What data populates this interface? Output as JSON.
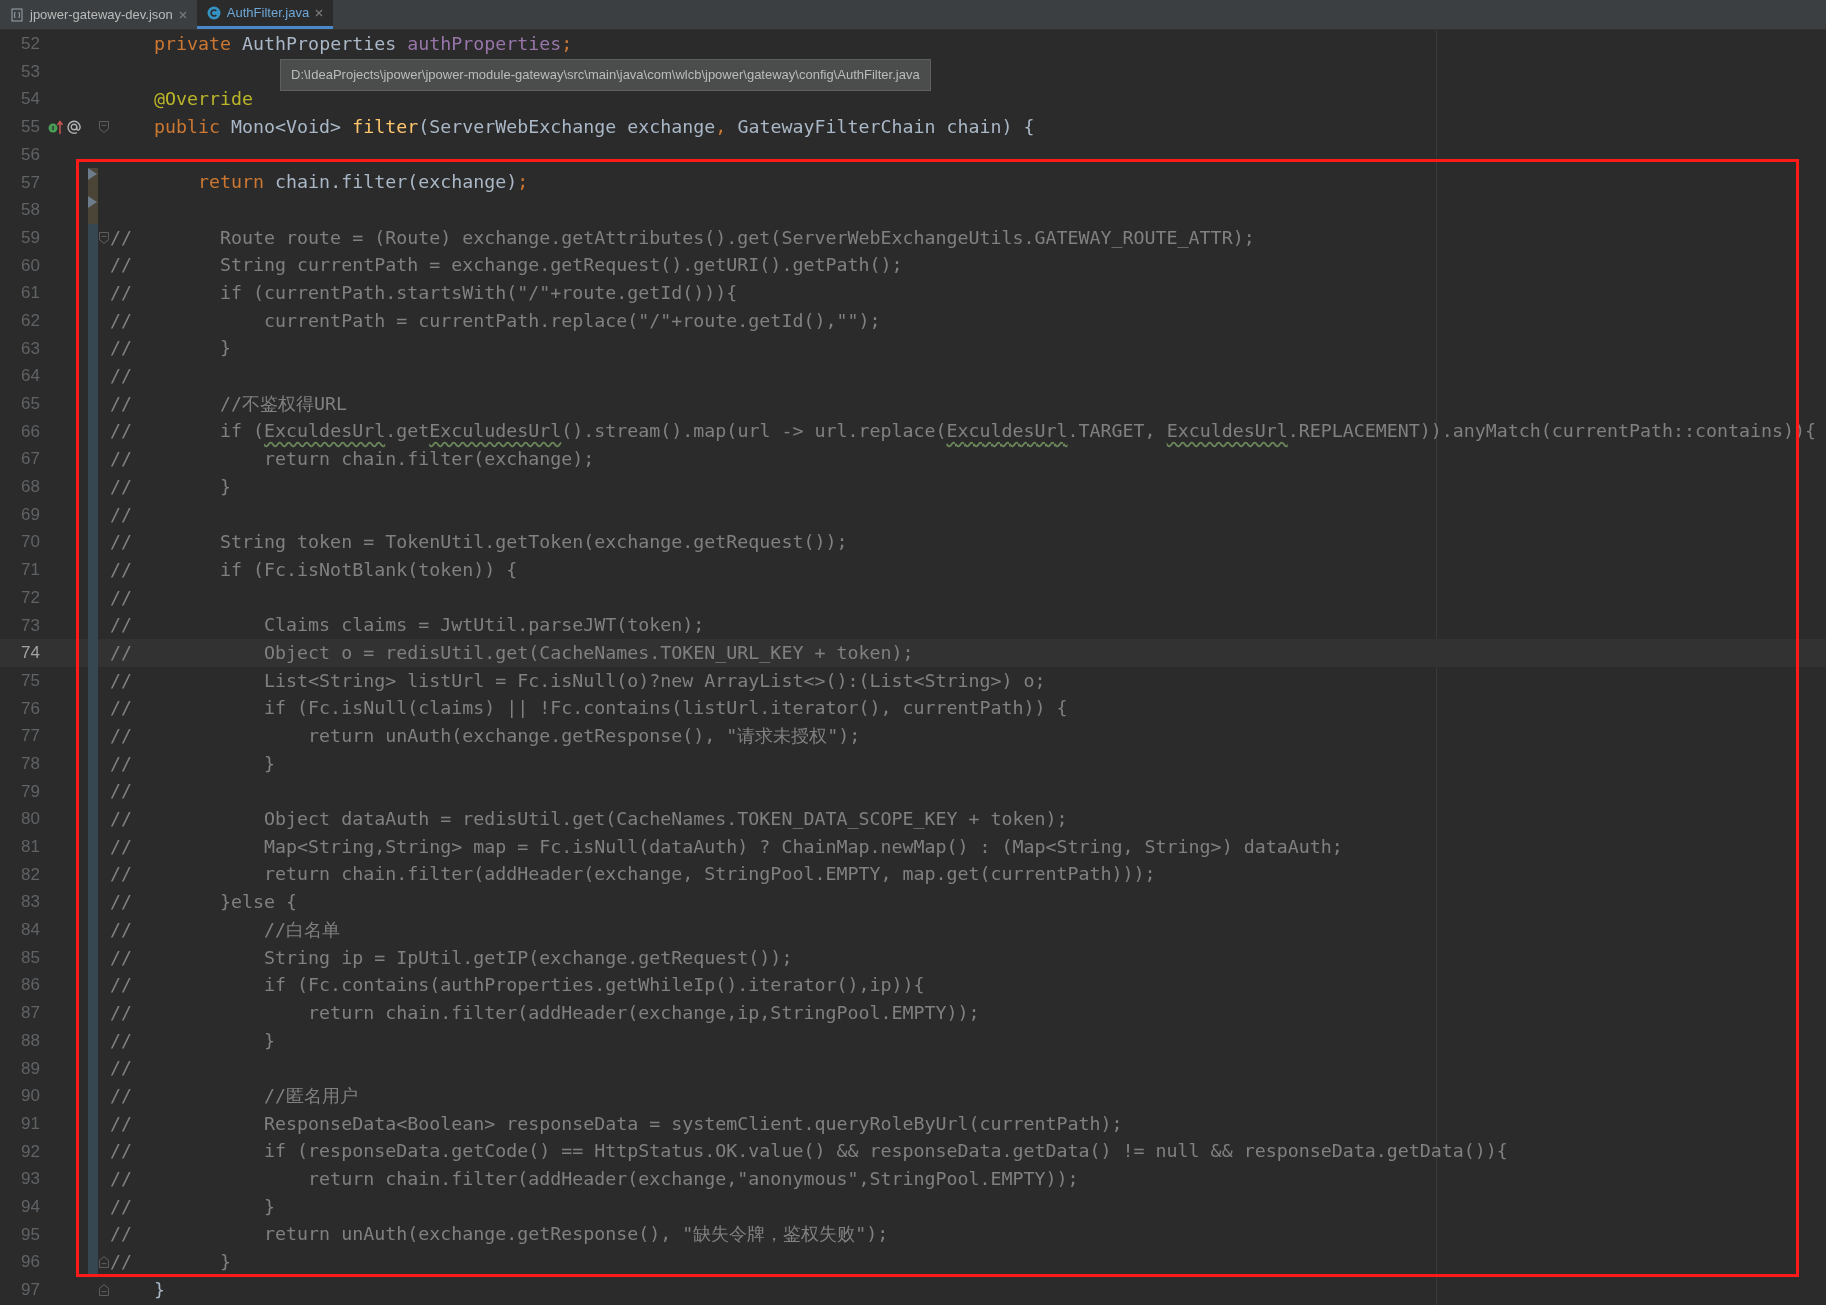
{
  "tabs": [
    {
      "label": "jpower-gateway-dev.json",
      "selected": false,
      "kind": "json"
    },
    {
      "label": "AuthFilter.java",
      "selected": true,
      "kind": "class"
    }
  ],
  "tooltip": "D:\\IdeaProjects\\jpower\\jpower-module-gateway\\src\\main\\java\\com\\wlcb\\jpower\\gateway\\config\\AuthFilter.java",
  "lines": [
    {
      "n": "52",
      "segs": [
        {
          "kind": "keyword",
          "text": "    private"
        },
        {
          "kind": "plain",
          "text": " AuthProperties "
        },
        {
          "kind": "field",
          "text": "authProperties"
        },
        {
          "kind": "keyword",
          "text": ";"
        }
      ],
      "current": false,
      "overrides": false,
      "modified": false,
      "deleted": false,
      "fold_start": false,
      "fold_end": false
    },
    {
      "n": "53",
      "current": false,
      "overrides": false,
      "modified": false,
      "deleted": false,
      "fold_start": false,
      "fold_end": false
    },
    {
      "n": "54",
      "segs": [
        {
          "kind": "annotation",
          "text": "    @Override"
        }
      ],
      "current": false,
      "overrides": false,
      "modified": false,
      "deleted": false,
      "fold_start": false,
      "fold_end": false
    },
    {
      "n": "55",
      "segs": [
        {
          "kind": "keyword",
          "text": "    public"
        },
        {
          "kind": "plain",
          "text": " Mono<Void> "
        },
        {
          "kind": "method",
          "text": "filter"
        },
        {
          "kind": "plain",
          "text": "(ServerWebExchange exchange"
        },
        {
          "kind": "keyword",
          "text": ","
        },
        {
          "kind": "plain",
          "text": " GatewayFilterChain chain) {"
        }
      ],
      "current": false,
      "overrides": true,
      "modified": false,
      "deleted": false,
      "fold_start": true,
      "fold_end": false
    },
    {
      "n": "56",
      "current": false,
      "overrides": false,
      "modified": false,
      "deleted": false,
      "fold_start": false,
      "fold_end": false
    },
    {
      "n": "57",
      "segs": [
        {
          "kind": "keyword",
          "text": "        return"
        },
        {
          "kind": "plain",
          "text": " chain.filter(exchange)"
        },
        {
          "kind": "keyword",
          "text": ";"
        }
      ],
      "current": false,
      "overrides": false,
      "modified": false,
      "deleted": true,
      "fold_start": false,
      "fold_end": false
    },
    {
      "n": "58",
      "current": false,
      "overrides": false,
      "modified": false,
      "deleted": true,
      "fold_start": false,
      "fold_end": false
    },
    {
      "n": "59",
      "segs": [
        {
          "kind": "comment",
          "text": "//        Route route = (Route) exchange.getAttributes().get(ServerWebExchangeUtils.GATEWAY_ROUTE_ATTR);"
        }
      ],
      "current": false,
      "overrides": false,
      "modified": true,
      "deleted": false,
      "fold_start": true,
      "fold_end": false
    },
    {
      "n": "60",
      "segs": [
        {
          "kind": "comment",
          "text": "//        String currentPath = exchange.getRequest().getURI().getPath();"
        }
      ],
      "current": false,
      "overrides": false,
      "modified": true,
      "deleted": false,
      "fold_start": false,
      "fold_end": false
    },
    {
      "n": "61",
      "segs": [
        {
          "kind": "comment",
          "text": "//        if (currentPath.startsWith(\"/\"+route.getId())){"
        }
      ],
      "current": false,
      "overrides": false,
      "modified": true,
      "deleted": false,
      "fold_start": false,
      "fold_end": false
    },
    {
      "n": "62",
      "segs": [
        {
          "kind": "comment",
          "text": "//            currentPath = currentPath.replace(\"/\"+route.getId(),\"\");"
        }
      ],
      "current": false,
      "overrides": false,
      "modified": true,
      "deleted": false,
      "fold_start": false,
      "fold_end": false
    },
    {
      "n": "63",
      "segs": [
        {
          "kind": "comment",
          "text": "//        }"
        }
      ],
      "current": false,
      "overrides": false,
      "modified": true,
      "deleted": false,
      "fold_start": false,
      "fold_end": false
    },
    {
      "n": "64",
      "segs": [
        {
          "kind": "comment",
          "text": "//"
        }
      ],
      "current": false,
      "overrides": false,
      "modified": true,
      "deleted": false,
      "fold_start": false,
      "fold_end": false
    },
    {
      "n": "65",
      "segs": [
        {
          "kind": "comment",
          "text": "//        //不鉴权得URL"
        }
      ],
      "current": false,
      "overrides": false,
      "modified": true,
      "deleted": false,
      "fold_start": false,
      "fold_end": false
    },
    {
      "n": "66",
      "segs": [
        {
          "kind": "comment",
          "text": "//        if ("
        },
        {
          "kind": "warning",
          "text": "ExculdesUrl"
        },
        {
          "kind": "comment",
          "text": ".get"
        },
        {
          "kind": "warning",
          "text": "ExculudesUrl"
        },
        {
          "kind": "comment",
          "text": "().stream().map(url -> url.replace("
        },
        {
          "kind": "warning",
          "text": "ExculdesUrl"
        },
        {
          "kind": "comment",
          "text": ".TARGET, "
        },
        {
          "kind": "warning",
          "text": "ExculdesUrl"
        },
        {
          "kind": "comment",
          "text": ".REPLACEMENT)).anyMatch(currentPath::contains)){"
        }
      ],
      "current": false,
      "overrides": false,
      "modified": true,
      "deleted": false,
      "fold_start": false,
      "fold_end": false
    },
    {
      "n": "67",
      "segs": [
        {
          "kind": "comment",
          "text": "//            return chain.filter(exchange);"
        }
      ],
      "current": false,
      "overrides": false,
      "modified": true,
      "deleted": false,
      "fold_start": false,
      "fold_end": false
    },
    {
      "n": "68",
      "segs": [
        {
          "kind": "comment",
          "text": "//        }"
        }
      ],
      "current": false,
      "overrides": false,
      "modified": true,
      "deleted": false,
      "fold_start": false,
      "fold_end": false
    },
    {
      "n": "69",
      "segs": [
        {
          "kind": "comment",
          "text": "//"
        }
      ],
      "current": false,
      "overrides": false,
      "modified": true,
      "deleted": false,
      "fold_start": false,
      "fold_end": false
    },
    {
      "n": "70",
      "segs": [
        {
          "kind": "comment",
          "text": "//        String token = TokenUtil.getToken(exchange.getRequest());"
        }
      ],
      "current": false,
      "overrides": false,
      "modified": true,
      "deleted": false,
      "fold_start": false,
      "fold_end": false
    },
    {
      "n": "71",
      "segs": [
        {
          "kind": "comment",
          "text": "//        if (Fc.isNotBlank(token)) {"
        }
      ],
      "current": false,
      "overrides": false,
      "modified": true,
      "deleted": false,
      "fold_start": false,
      "fold_end": false
    },
    {
      "n": "72",
      "segs": [
        {
          "kind": "comment",
          "text": "//"
        }
      ],
      "current": false,
      "overrides": false,
      "modified": true,
      "deleted": false,
      "fold_start": false,
      "fold_end": false
    },
    {
      "n": "73",
      "segs": [
        {
          "kind": "comment",
          "text": "//            Claims claims = JwtUtil.parseJWT(token);"
        }
      ],
      "current": false,
      "overrides": false,
      "modified": true,
      "deleted": false,
      "fold_start": false,
      "fold_end": false
    },
    {
      "n": "74",
      "segs": [
        {
          "kind": "comment",
          "text": "//            Object o = redisUtil.get(CacheNames.TOKEN_URL_KEY + token);"
        }
      ],
      "current": true,
      "overrides": false,
      "modified": true,
      "deleted": false,
      "fold_start": false,
      "fold_end": false
    },
    {
      "n": "75",
      "segs": [
        {
          "kind": "comment",
          "text": "//            List<String> listUrl = Fc.isNull(o)?new ArrayList<>():(List<String>) o;"
        }
      ],
      "current": false,
      "overrides": false,
      "modified": true,
      "deleted": false,
      "fold_start": false,
      "fold_end": false
    },
    {
      "n": "76",
      "segs": [
        {
          "kind": "comment",
          "text": "//            if (Fc.isNull(claims) || !Fc.contains(listUrl.iterator(), currentPath)) {"
        }
      ],
      "current": false,
      "overrides": false,
      "modified": true,
      "deleted": false,
      "fold_start": false,
      "fold_end": false
    },
    {
      "n": "77",
      "segs": [
        {
          "kind": "comment",
          "text": "//                return unAuth(exchange.getResponse(), \"请求未授权\");"
        }
      ],
      "current": false,
      "overrides": false,
      "modified": true,
      "deleted": false,
      "fold_start": false,
      "fold_end": false
    },
    {
      "n": "78",
      "segs": [
        {
          "kind": "comment",
          "text": "//            }"
        }
      ],
      "current": false,
      "overrides": false,
      "modified": true,
      "deleted": false,
      "fold_start": false,
      "fold_end": false
    },
    {
      "n": "79",
      "segs": [
        {
          "kind": "comment",
          "text": "//"
        }
      ],
      "current": false,
      "overrides": false,
      "modified": true,
      "deleted": false,
      "fold_start": false,
      "fold_end": false
    },
    {
      "n": "80",
      "segs": [
        {
          "kind": "comment",
          "text": "//            Object dataAuth = redisUtil.get(CacheNames.TOKEN_DATA_SCOPE_KEY + token);"
        }
      ],
      "current": false,
      "overrides": false,
      "modified": true,
      "deleted": false,
      "fold_start": false,
      "fold_end": false
    },
    {
      "n": "81",
      "segs": [
        {
          "kind": "comment",
          "text": "//            Map<String,String> map = Fc.isNull(dataAuth) ? ChainMap.newMap() : (Map<String, String>) dataAuth;"
        }
      ],
      "current": false,
      "overrides": false,
      "modified": true,
      "deleted": false,
      "fold_start": false,
      "fold_end": false
    },
    {
      "n": "82",
      "segs": [
        {
          "kind": "comment",
          "text": "//            return chain.filter(addHeader(exchange, StringPool.EMPTY, map.get(currentPath)));"
        }
      ],
      "current": false,
      "overrides": false,
      "modified": true,
      "deleted": false,
      "fold_start": false,
      "fold_end": false
    },
    {
      "n": "83",
      "segs": [
        {
          "kind": "comment",
          "text": "//        }else {"
        }
      ],
      "current": false,
      "overrides": false,
      "modified": true,
      "deleted": false,
      "fold_start": false,
      "fold_end": false
    },
    {
      "n": "84",
      "segs": [
        {
          "kind": "comment",
          "text": "//            //白名单"
        }
      ],
      "current": false,
      "overrides": false,
      "modified": true,
      "deleted": false,
      "fold_start": false,
      "fold_end": false
    },
    {
      "n": "85",
      "segs": [
        {
          "kind": "comment",
          "text": "//            String ip = IpUtil.getIP(exchange.getRequest());"
        }
      ],
      "current": false,
      "overrides": false,
      "modified": true,
      "deleted": false,
      "fold_start": false,
      "fold_end": false
    },
    {
      "n": "86",
      "segs": [
        {
          "kind": "comment",
          "text": "//            if (Fc.contains(authProperties.getWhileIp().iterator(),ip)){"
        }
      ],
      "current": false,
      "overrides": false,
      "modified": true,
      "deleted": false,
      "fold_start": false,
      "fold_end": false
    },
    {
      "n": "87",
      "segs": [
        {
          "kind": "comment",
          "text": "//                return chain.filter(addHeader(exchange,ip,StringPool.EMPTY));"
        }
      ],
      "current": false,
      "overrides": false,
      "modified": true,
      "deleted": false,
      "fold_start": false,
      "fold_end": false
    },
    {
      "n": "88",
      "segs": [
        {
          "kind": "comment",
          "text": "//            }"
        }
      ],
      "current": false,
      "overrides": false,
      "modified": true,
      "deleted": false,
      "fold_start": false,
      "fold_end": false
    },
    {
      "n": "89",
      "segs": [
        {
          "kind": "comment",
          "text": "//"
        }
      ],
      "current": false,
      "overrides": false,
      "modified": true,
      "deleted": false,
      "fold_start": false,
      "fold_end": false
    },
    {
      "n": "90",
      "segs": [
        {
          "kind": "comment",
          "text": "//            //匿名用户"
        }
      ],
      "current": false,
      "overrides": false,
      "modified": true,
      "deleted": false,
      "fold_start": false,
      "fold_end": false
    },
    {
      "n": "91",
      "segs": [
        {
          "kind": "comment",
          "text": "//            ResponseData<Boolean> responseData = systemClient.queryRoleByUrl(currentPath);"
        }
      ],
      "current": false,
      "overrides": false,
      "modified": true,
      "deleted": false,
      "fold_start": false,
      "fold_end": false
    },
    {
      "n": "92",
      "segs": [
        {
          "kind": "comment",
          "text": "//            if (responseData.getCode() == HttpStatus.OK.value() && responseData.getData() != null && responseData.getData()){"
        }
      ],
      "current": false,
      "overrides": false,
      "modified": true,
      "deleted": false,
      "fold_start": false,
      "fold_end": false
    },
    {
      "n": "93",
      "segs": [
        {
          "kind": "comment",
          "text": "//                return chain.filter(addHeader(exchange,\"anonymous\",StringPool.EMPTY));"
        }
      ],
      "current": false,
      "overrides": false,
      "modified": true,
      "deleted": false,
      "fold_start": false,
      "fold_end": false
    },
    {
      "n": "94",
      "segs": [
        {
          "kind": "comment",
          "text": "//            }"
        }
      ],
      "current": false,
      "overrides": false,
      "modified": true,
      "deleted": false,
      "fold_start": false,
      "fold_end": false
    },
    {
      "n": "95",
      "segs": [
        {
          "kind": "comment",
          "text": "//            return unAuth(exchange.getResponse(), \"缺失令牌，鉴权失败\");"
        }
      ],
      "current": false,
      "overrides": false,
      "modified": true,
      "deleted": false,
      "fold_start": false,
      "fold_end": false
    },
    {
      "n": "96",
      "segs": [
        {
          "kind": "comment",
          "text": "//        }"
        }
      ],
      "current": false,
      "overrides": false,
      "modified": true,
      "deleted": false,
      "fold_start": false,
      "fold_end": true
    },
    {
      "n": "97",
      "segs": [
        {
          "kind": "plain",
          "text": "    }"
        }
      ],
      "current": false,
      "overrides": false,
      "modified": false,
      "deleted": false,
      "fold_start": false,
      "fold_end": true
    }
  ]
}
